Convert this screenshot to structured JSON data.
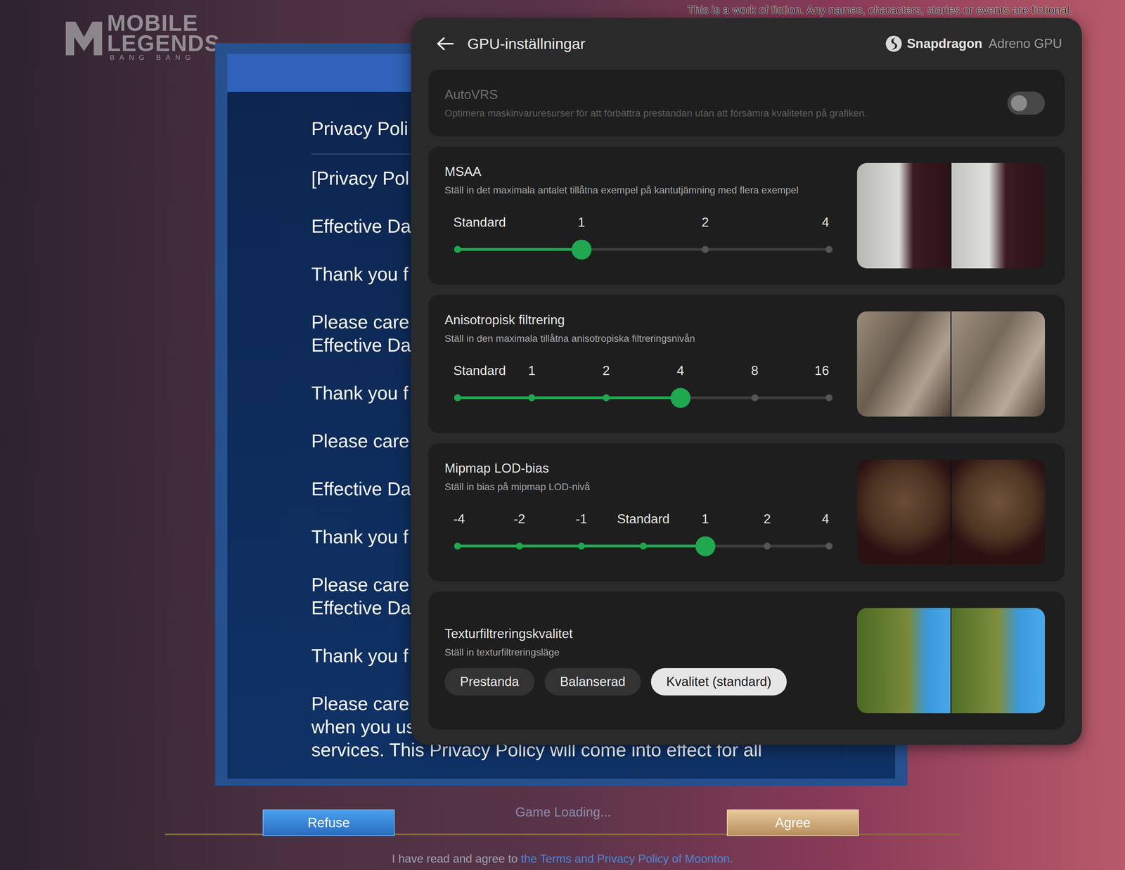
{
  "disclaimer": "This is a work of fiction. Any names, characters, stories or events are fictional.",
  "logo": {
    "line1": "MOBILE",
    "line2": "LEGENDS",
    "line3": "BANG BANG"
  },
  "privacy_dialog": {
    "heading": "Privacy Poli",
    "paragraphs": [
      [
        "[Privacy Pol"
      ],
      [
        "Effective Da"
      ],
      [
        "Thank you f"
      ],
      [
        "Please care",
        "Effective Da"
      ],
      [
        "Thank you f"
      ],
      [
        "Please care"
      ],
      [
        "Effective Da"
      ],
      [
        "Thank you f"
      ],
      [
        "Please care",
        "Effective Da"
      ],
      [
        "Thank you f"
      ],
      [
        "Please care",
        "when you us",
        "services. This Privacy Policy will come into effect for all"
      ]
    ],
    "buttons": [
      {
        "label": "Refuse",
        "kind": "secondary"
      },
      {
        "label": "Agree",
        "kind": "primary"
      }
    ],
    "loading": "Game Loading...",
    "agreement": {
      "prefix": "I have read and agree to ",
      "link": "the Terms and Privacy Policy of Moonton."
    }
  },
  "gpu_panel": {
    "title": "GPU-inställningar",
    "brand": "Snapdragon",
    "gpu": "Adreno GPU",
    "settings": [
      {
        "kind": "toggle",
        "title": "AutoVRS",
        "description": "Optimera maskinvaruresurser för att förbättra prestandan utan att försämra kvaliteten på grafiken.",
        "on": false,
        "disabled": true
      },
      {
        "kind": "slider",
        "title": "MSAA",
        "description": "Ställ in det maximala antalet tillåtna exempel på kantutjämning med flera exempel",
        "stops": [
          "Standard",
          "1",
          "2",
          "4"
        ],
        "level": 0.3333
      },
      {
        "kind": "slider",
        "title": "Anisotropisk filtrering",
        "description": "Ställ in den maximala tillåtna anisotropiska filtreringsnivån",
        "stops": [
          "Standard",
          "1",
          "2",
          "4",
          "8",
          "16"
        ],
        "level": 0.6
      },
      {
        "kind": "slider",
        "title": "Mipmap LOD-bias",
        "description": "Ställ in bias på mipmap LOD-nivå",
        "stops": [
          "-4",
          "-2",
          "-1",
          "Standard",
          "1",
          "2",
          "4"
        ],
        "level": 0.6667
      },
      {
        "kind": "choice",
        "title": "Texturfiltreringskvalitet",
        "description": "Ställ in texturfiltreringsläge",
        "options": [
          {
            "label": "Prestanda",
            "selected": false
          },
          {
            "label": "Balanserad",
            "selected": false
          },
          {
            "label": "Kvalitet (standard)",
            "selected": true
          }
        ]
      }
    ]
  }
}
